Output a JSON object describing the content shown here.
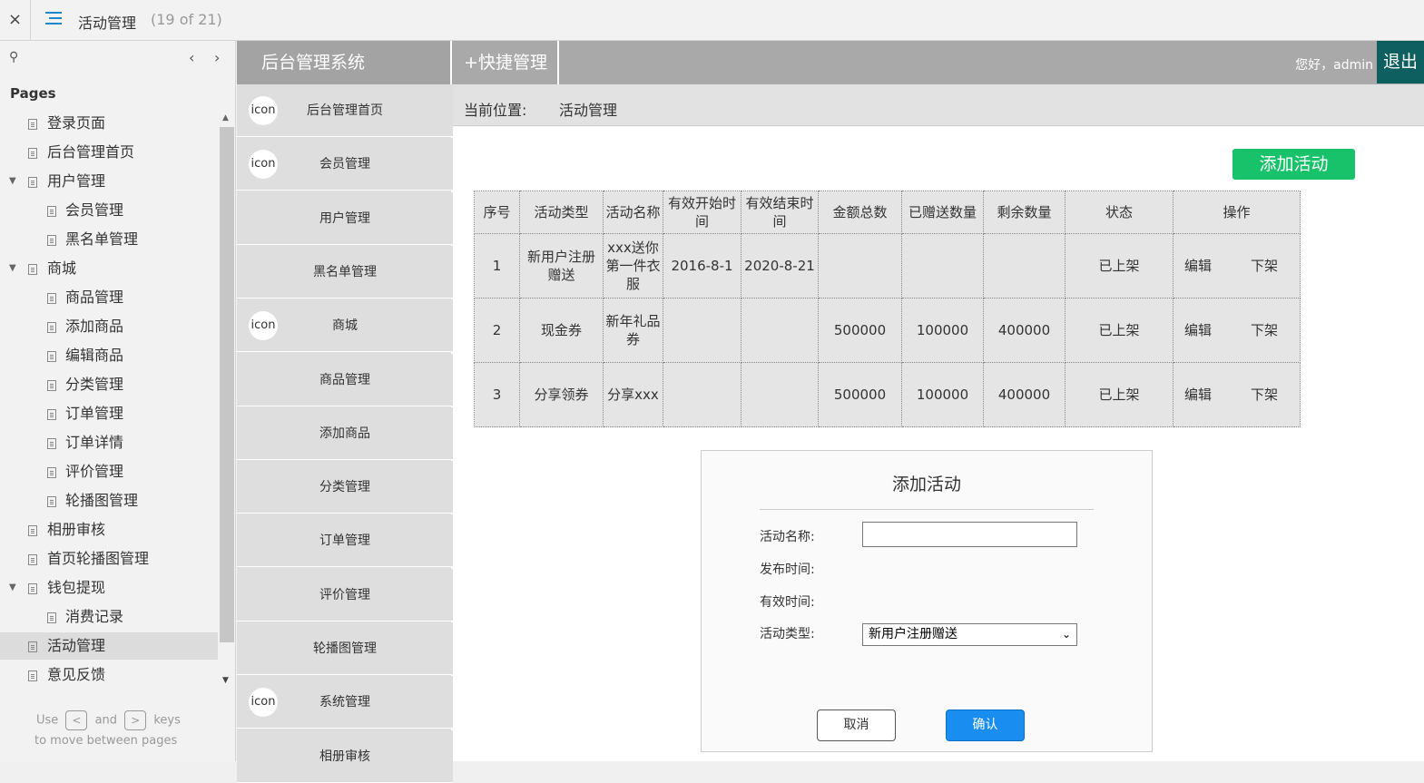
{
  "topbar": {
    "close": "×",
    "title": "活动管理",
    "count": "(19 of 21)"
  },
  "tree": {
    "heading": "Pages",
    "items": [
      {
        "label": "登录页面",
        "indent": 0
      },
      {
        "label": "后台管理首页",
        "indent": 0
      },
      {
        "label": "用户管理",
        "indent": 0,
        "expanded": true
      },
      {
        "label": "会员管理",
        "indent": 1
      },
      {
        "label": "黑名单管理",
        "indent": 1
      },
      {
        "label": "商城",
        "indent": 0,
        "expanded": true
      },
      {
        "label": "商品管理",
        "indent": 1
      },
      {
        "label": "添加商品",
        "indent": 1
      },
      {
        "label": "编辑商品",
        "indent": 1
      },
      {
        "label": "分类管理",
        "indent": 1
      },
      {
        "label": "订单管理",
        "indent": 1
      },
      {
        "label": "订单详情",
        "indent": 1
      },
      {
        "label": "评价管理",
        "indent": 1
      },
      {
        "label": "轮播图管理",
        "indent": 1
      },
      {
        "label": "相册审核",
        "indent": 0
      },
      {
        "label": "首页轮播图管理",
        "indent": 0
      },
      {
        "label": "钱包提现",
        "indent": 0,
        "expanded": true
      },
      {
        "label": "消费记录",
        "indent": 1
      },
      {
        "label": "活动管理",
        "indent": 0,
        "selected": true
      },
      {
        "label": "意见反馈",
        "indent": 0
      }
    ],
    "hint": {
      "use": "Use",
      "key_prev": "<",
      "and": "and",
      "key_next": ">",
      "keys": "keys",
      "line2": "to move between pages"
    }
  },
  "header": {
    "brand": "后台管理系统",
    "quick": "+快捷管理",
    "greeting": "您好，admin",
    "logout": "退出"
  },
  "sidebar": {
    "icon_text": "icon",
    "items": [
      {
        "label": "后台管理首页",
        "icon": true
      },
      {
        "label": "会员管理",
        "icon": true
      },
      {
        "label": "用户管理",
        "icon": false
      },
      {
        "label": "黑名单管理",
        "icon": false
      },
      {
        "label": "商城",
        "icon": true
      },
      {
        "label": "商品管理",
        "icon": false
      },
      {
        "label": "添加商品",
        "icon": false
      },
      {
        "label": "分类管理",
        "icon": false
      },
      {
        "label": "订单管理",
        "icon": false
      },
      {
        "label": "评价管理",
        "icon": false
      },
      {
        "label": "轮播图管理",
        "icon": false
      },
      {
        "label": "系统管理",
        "icon": true
      },
      {
        "label": "相册审核",
        "icon": false
      }
    ]
  },
  "breadcrumb": {
    "label": "当前位置:",
    "value": "活动管理"
  },
  "add_button": "添加活动",
  "table": {
    "headers": [
      "序号",
      "活动类型",
      "活动名称",
      "有效开始时间",
      "有效结束时间",
      "金额总数",
      "已赠送数量",
      "剩余数量",
      "状态",
      "操作"
    ],
    "rows": [
      [
        "1",
        "新用户注册赠送",
        "xxx送你第一件衣服",
        "2016-8-1",
        "2020-8-21",
        "",
        "",
        "",
        "已上架"
      ],
      [
        "2",
        "现金券",
        "新年礼品券",
        "",
        "",
        "500000",
        "100000",
        "400000",
        "已上架"
      ],
      [
        "3",
        "分享领券",
        "分享xxx",
        "",
        "",
        "500000",
        "100000",
        "400000",
        "已上架"
      ]
    ],
    "action_edit": "编辑",
    "action_off": "下架"
  },
  "dialog": {
    "title": "添加活动",
    "name_label": "活动名称:",
    "name_value": "",
    "publish_label": "发布时间:",
    "valid_label": "有效时间:",
    "type_label": "活动类型:",
    "type_value": "新用户注册赠送",
    "cancel": "取消",
    "confirm": "确认"
  },
  "colors": {
    "accent_green": "#17c26a",
    "confirm_blue": "#1a8ef0",
    "logout_bg": "#0e5f5f",
    "header_gray": "#a9a9a9"
  }
}
